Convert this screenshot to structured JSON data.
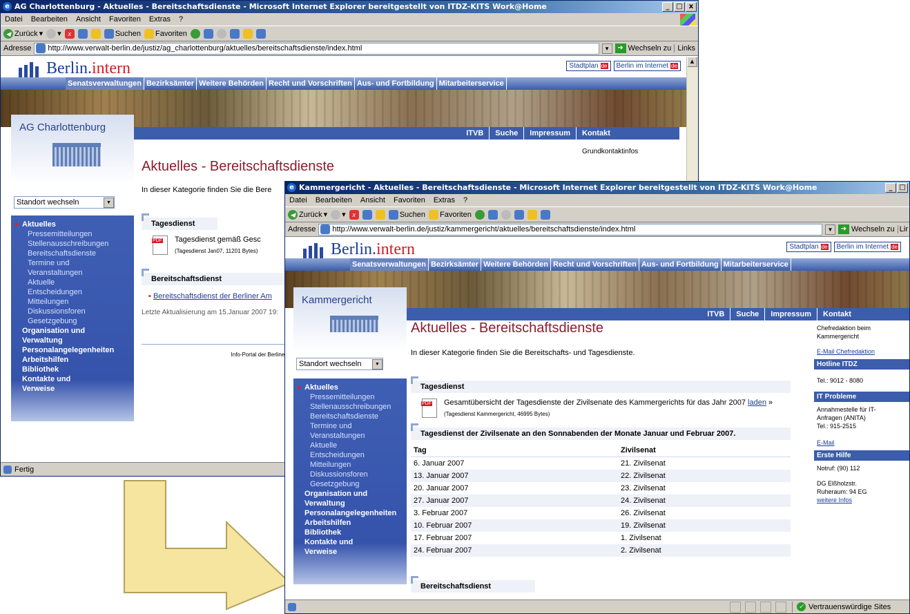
{
  "win1": {
    "title": "AG Charlottenburg - Aktuelles - Bereitschaftsdienste - Microsoft Internet Explorer bereitgestellt von ITDZ-KITS Work@Home",
    "menu": [
      "Datei",
      "Bearbeiten",
      "Ansicht",
      "Favoriten",
      "Extras",
      "?"
    ],
    "toolbar": {
      "back": "Zurück",
      "search": "Suchen",
      "favorites": "Favoriten"
    },
    "address_label": "Adresse",
    "url": "http://www.verwalt-berlin.de/justiz/ag_charlottenburg/aktuelles/bereitschaftsdienste/index.html",
    "go": "Wechseln zu",
    "links": "Links",
    "status": "Fertig",
    "site": {
      "logo_a": "Berlin.",
      "logo_b": "intern",
      "hlinks": [
        "Stadtplan",
        "Berlin im Internet"
      ],
      "nav": [
        "Senatsverwaltungen",
        "Bezirksämter",
        "Weitere Behörden",
        "Recht und Vorschriften",
        "Aus- und Fortbildung",
        "Mitarbeiterservice"
      ],
      "topnav": [
        "ITVB",
        "Suche",
        "Impressum",
        "Kontakt"
      ],
      "right_text": "Grundkontaktinfos",
      "side_name": "AG Charlottenburg",
      "standort": "Standort wechseln",
      "sidenav": {
        "active": "Aktuelles",
        "subs": [
          "Pressemitteilungen",
          "Stellenausschreibungen",
          "Bereitschaftsdienste",
          "Termine und",
          "Veranstaltungen",
          "Aktuelle",
          "Entscheidungen",
          "Mitteilungen",
          "Diskussionsforen",
          "Gesetzgebung"
        ],
        "tops": [
          "Organisation und",
          "Verwaltung",
          "Personalangelegenheiten",
          "Arbeitshilfen",
          "Bibliothek",
          "Kontakte und",
          "Verweise"
        ]
      },
      "heading": "Aktuelles - Bereitschaftsdienste",
      "intro": "In dieser Kategorie finden Sie die Bere",
      "sec1": "Tagesdienst",
      "pdf1_line": "Tagesdienst gemäß Gesc",
      "pdf1_meta": "(Tagesdienst Jan07, 11201 Bytes)",
      "sec2": "Bereitschaftsdienst",
      "link2": "Bereitschaftsdienst der Berliner Am",
      "updated": "Letzte Aktualisierung am 15.Januar 2007 19:",
      "footer": "Info-Portal der Berliner"
    }
  },
  "win2": {
    "title": "Kammergericht - Aktuelles - Bereitschaftsdienste - Microsoft Internet Explorer bereitgestellt von ITDZ-KITS Work@Home",
    "menu": [
      "Datei",
      "Bearbeiten",
      "Ansicht",
      "Favoriten",
      "Extras",
      "?"
    ],
    "toolbar": {
      "back": "Zurück",
      "search": "Suchen",
      "favorites": "Favoriten"
    },
    "address_label": "Adresse",
    "url": "http://www.verwalt-berlin.de/justiz/kammergericht/aktuelles/bereitschaftsdienste/index.html",
    "go": "Wechseln zu",
    "links": "Lir",
    "status_zone": "Vertrauenswürdige Sites",
    "site": {
      "logo_a": "Berlin.",
      "logo_b": "intern",
      "hlinks": [
        "Stadtplan",
        "Berlin im Internet"
      ],
      "nav": [
        "Senatsverwaltungen",
        "Bezirksämter",
        "Weitere Behörden",
        "Recht und Vorschriften",
        "Aus- und Fortbildung",
        "Mitarbeiterservice"
      ],
      "topnav": [
        "ITVB",
        "Suche",
        "Impressum",
        "Kontakt"
      ],
      "side_name": "Kammergericht",
      "standort": "Standort wechseln",
      "sidenav": {
        "active": "Aktuelles",
        "subs": [
          "Pressemitteilungen",
          "Stellenausschreibungen",
          "Bereitschaftsdienste",
          "Termine und",
          "Veranstaltungen",
          "Aktuelle",
          "Entscheidungen",
          "Mitteilungen",
          "Diskussionsforen",
          "Gesetzgebung"
        ],
        "tops": [
          "Organisation und",
          "Verwaltung",
          "Personalangelegenheiten",
          "Arbeitshilfen",
          "Bibliothek",
          "Kontakte und",
          "Verweise"
        ]
      },
      "heading": "Aktuelles - Bereitschaftsdienste",
      "intro": "In dieser Kategorie finden Sie die Bereitschafts- und Tagesdienste.",
      "sec1": "Tagesdienst",
      "pdf1_line": "Gesamtübersicht der Tagesdienste der Zivilsenate des Kammergerichts für das Jahr 2007",
      "pdf1_link": "laden",
      "pdf1_meta": "(Tagesdienst Kammergericht, 46995 Bytes)",
      "table_title": "Tagesdienst der Zivilsenate an den Sonnabenden der Monate Januar und Februar 2007.",
      "table_head": [
        "Tag",
        "Zivilsenat"
      ],
      "rows": [
        [
          "6. Januar 2007",
          "21. Zivilsenat"
        ],
        [
          "13. Januar 2007",
          "22. Zivilsenat"
        ],
        [
          "20. Januar 2007",
          "23. Zivilsenat"
        ],
        [
          "27. Januar 2007",
          "24. Zivilsenat"
        ],
        [
          "3. Februar 2007",
          "26. Zivilsenat"
        ],
        [
          "10. Februar 2007",
          "19. Zivilsenat"
        ],
        [
          "17. Februar 2007",
          "1. Zivilsenat"
        ],
        [
          "24. Februar 2007",
          "2. Zivilsenat"
        ]
      ],
      "sec2": "Bereitschaftsdienst",
      "right": {
        "kontakt_body1": "Chefredaktion beim",
        "kontakt_body2": "Kammergericht",
        "kontakt_link": "E-Mail Chefredaktion",
        "hotline_head": "Hotline ITDZ",
        "hotline_body": "Tel.: 9012 - 8080",
        "it_head": "IT Probleme",
        "it_body1": "Annahmestelle für IT-",
        "it_body2": "Anfragen (ANITA)",
        "it_body3": "Tel.: 915-2515",
        "it_link": "E-Mail",
        "eh_head": "Erste Hilfe",
        "eh_body1": "Notruf: (90) 112",
        "eh_body2": "DG Elßholzstr.",
        "eh_body3": "Ruheraum: 94 EG",
        "eh_link": "weitere Infos"
      }
    }
  }
}
